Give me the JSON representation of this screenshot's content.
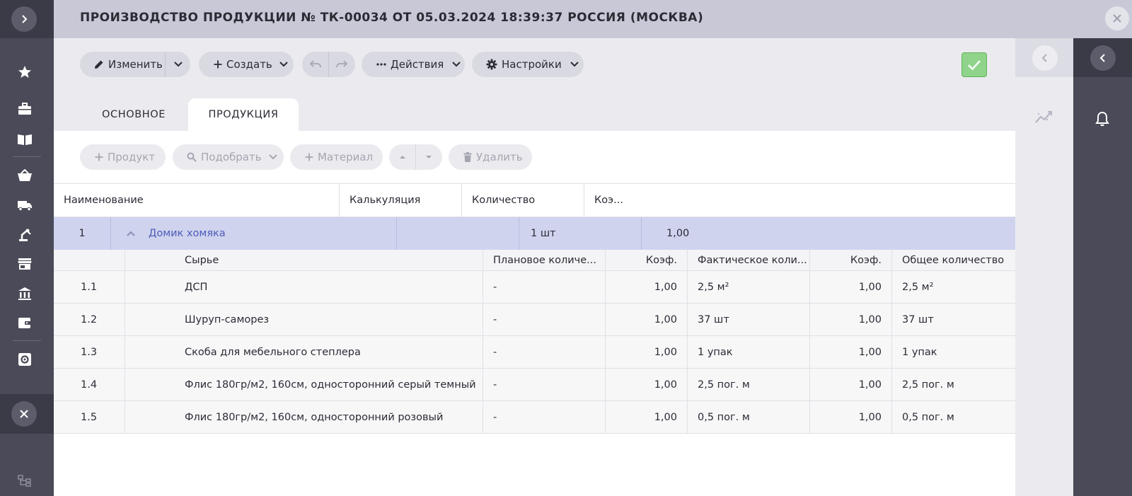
{
  "header": {
    "title": "ПРОИЗВОДСТВО ПРОДУКЦИИ № ТК-00034 ОТ 05.03.2024 18:39:37 РОССИЯ (МОСКВА)"
  },
  "toolbar": {
    "edit_label": "Изменить",
    "create_label": "Создать",
    "actions_label": "Действия",
    "settings_label": "Настройки"
  },
  "tabs": [
    {
      "label": "ОСНОВНОЕ",
      "active": false
    },
    {
      "label": "ПРОДУКЦИЯ",
      "active": true
    }
  ],
  "subtoolbar": {
    "product_label": "Продукт",
    "pick_label": "Подобрать",
    "material_label": "Материал",
    "delete_label": "Удалить"
  },
  "table": {
    "columns": [
      "Наименование",
      "Калькуляция",
      "Количество",
      "Коэ..."
    ],
    "product_row": {
      "num": "1",
      "name": "Домик хомяка",
      "calc": "",
      "qty": "1 шт",
      "coef": "1,00"
    },
    "sub_columns": [
      "Сырье",
      "Плановое количе...",
      "Коэф.",
      "Фактическое коли...",
      "Коэф.",
      "Общее количество"
    ],
    "materials": [
      {
        "num": "1.1",
        "name": "ДСП",
        "planned": "-",
        "coef1": "1,00",
        "actual": "2,5 м²",
        "coef2": "1,00",
        "total": "2,5 м²"
      },
      {
        "num": "1.2",
        "name": "Шуруп-саморез",
        "planned": "-",
        "coef1": "1,00",
        "actual": "37 шт",
        "coef2": "1,00",
        "total": "37 шт"
      },
      {
        "num": "1.3",
        "name": "Скоба для мебельного степлера",
        "planned": "-",
        "coef1": "1,00",
        "actual": "1 упак",
        "coef2": "1,00",
        "total": "1 упак"
      },
      {
        "num": "1.4",
        "name": "Флис 180гр/м2, 160см, односторонний серый темный",
        "planned": "-",
        "coef1": "1,00",
        "actual": "2,5 пог. м",
        "coef2": "1,00",
        "total": "2,5 пог. м"
      },
      {
        "num": "1.5",
        "name": "Флис 180гр/м2, 160см, односторонний розовый",
        "planned": "-",
        "coef1": "1,00",
        "actual": "0,5 пог. м",
        "coef2": "1,00",
        "total": "0,5 пог. м"
      }
    ]
  },
  "icons": {
    "left_rail": [
      "chevron-right-icon",
      "star-icon",
      "briefcase-icon",
      "book-icon",
      "basket-icon",
      "truck-icon",
      "factory-robot-icon",
      "store-icon",
      "bank-icon",
      "wallet-icon",
      "settings-box-icon",
      "close-icon",
      "hierarchy-icon"
    ],
    "right": [
      "chevron-left-icon",
      "analytics-icon",
      "bell-icon"
    ]
  },
  "colors": {
    "accent_link": "#4d5cb8",
    "selected_row": "#cfd3ee",
    "confirm_green": "#8fd48a",
    "rail_dark": "#4a4a58"
  }
}
